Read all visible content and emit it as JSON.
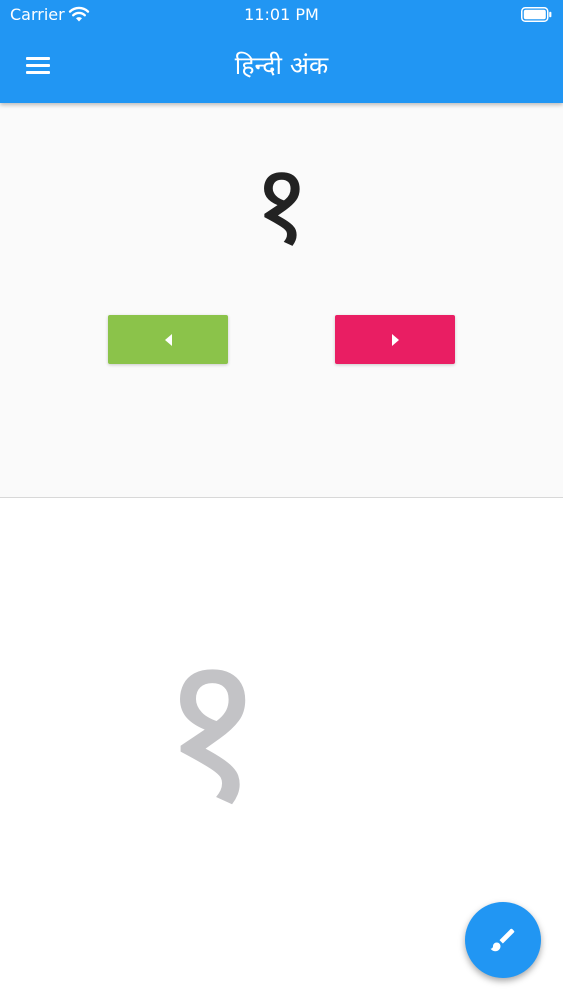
{
  "status_bar": {
    "carrier": "Carrier",
    "time": "11:01 PM",
    "wifi_icon": "wifi-icon",
    "battery_icon": "battery-icon"
  },
  "app_bar": {
    "title": "हिन्दी अंक",
    "menu_icon": "hamburger-menu-icon",
    "color": "#2196F3"
  },
  "digit_panel": {
    "current_digit": "१",
    "prev_button_icon": "arrow-left-icon",
    "next_button_icon": "arrow-right-icon",
    "prev_color": "#8BC34A",
    "next_color": "#E91E63"
  },
  "drawing_area": {
    "trace_digit": "१",
    "trace_color": "#C3C3C6"
  },
  "fab": {
    "icon": "brush-icon",
    "color": "#2196F3"
  }
}
